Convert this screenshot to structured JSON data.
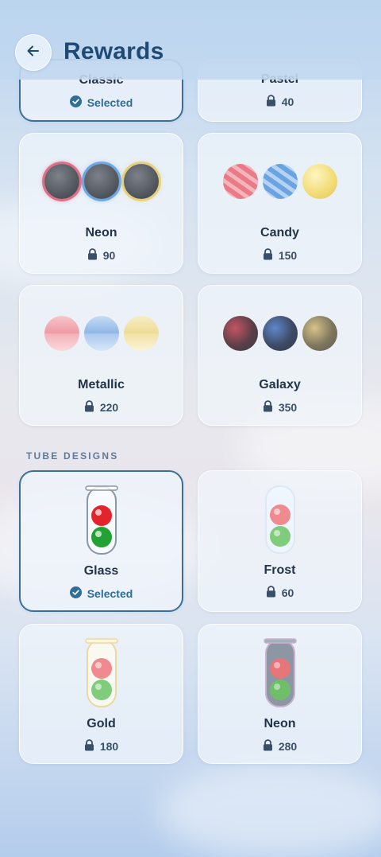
{
  "header": {
    "title": "Rewards",
    "back_icon": "arrow-left-icon"
  },
  "ball_designs": [
    {
      "name": "Classic",
      "status": "Selected",
      "selected": true
    },
    {
      "name": "Pastel",
      "price": "40",
      "selected": false
    },
    {
      "name": "Neon",
      "price": "90",
      "selected": false
    },
    {
      "name": "Candy",
      "price": "150",
      "selected": false
    },
    {
      "name": "Metallic",
      "price": "220",
      "selected": false
    },
    {
      "name": "Galaxy",
      "price": "350",
      "selected": false
    }
  ],
  "tube_section": {
    "label": "TUBE DESIGNS"
  },
  "tube_designs": [
    {
      "name": "Glass",
      "status": "Selected",
      "selected": true
    },
    {
      "name": "Frost",
      "price": "60",
      "selected": false
    },
    {
      "name": "Gold",
      "price": "180",
      "selected": false
    },
    {
      "name": "Neon",
      "price": "280",
      "selected": false
    }
  ],
  "colors": {
    "accent": "#3a6f99",
    "title": "#1f4a73",
    "text": "#22344a"
  }
}
